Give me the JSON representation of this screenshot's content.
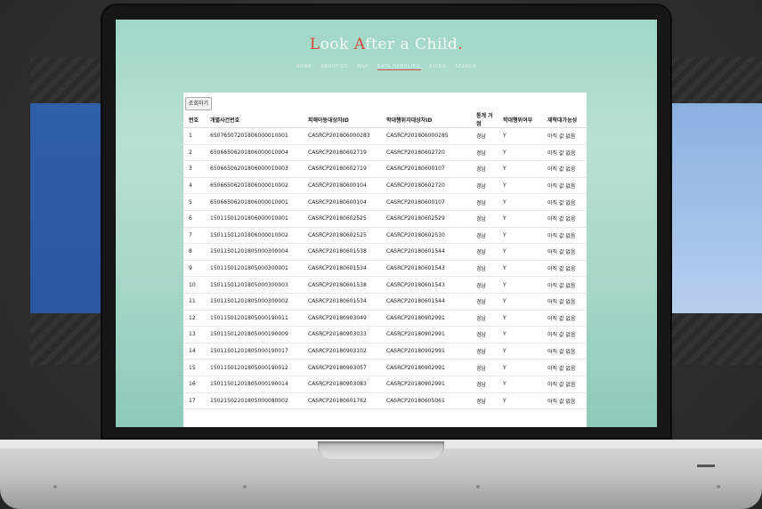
{
  "site": {
    "title_parts": [
      {
        "initial": "L",
        "rest": "ook "
      },
      {
        "initial": "A",
        "rest": "fter a Child"
      }
    ],
    "title_end": ".",
    "nav": [
      "HOME",
      "ABOUT US",
      "MAP",
      "DATA HANDLING",
      "VIDEO",
      "SEARCH"
    ],
    "active_nav": 3
  },
  "panel": {
    "query_button": "조회하기",
    "headers": [
      "번호",
      "개별사건번호",
      "피해아동대상자ID",
      "학대행위자대상자ID",
      "통계 거점",
      "학대행위여부",
      "재학대가능성"
    ],
    "rows": [
      [
        "1",
        "65076507201806000010001",
        "CASRCP201806000283",
        "CASRCP201806000285",
        "경남",
        "Y",
        "아직 값 없음"
      ],
      [
        "2",
        "65066506201806000010004",
        "CASRCP20180602719",
        "CASRCP20180602720",
        "경남",
        "Y",
        "아직 값 없음"
      ],
      [
        "3",
        "65066506201806000010003",
        "CASRCP20180602719",
        "CASRCP20180600107",
        "경남",
        "Y",
        "아직 값 없음"
      ],
      [
        "4",
        "65066506201806000010002",
        "CASRCP20180600104",
        "CASRCP20180602720",
        "경남",
        "Y",
        "아직 값 없음"
      ],
      [
        "5",
        "65066506201806000010001",
        "CASRCP20180600104",
        "CASRCP20180600107",
        "경남",
        "Y",
        "아직 값 없음"
      ],
      [
        "6",
        "15011501201806000010001",
        "CASRCP20180602525",
        "CASRCP20180602529",
        "경남",
        "Y",
        "아직 값 없음"
      ],
      [
        "7",
        "15011501201806000010002",
        "CASRCP20180602525",
        "CASRCP20180602530",
        "경남",
        "Y",
        "아직 값 없음"
      ],
      [
        "8",
        "15011501201805000300004",
        "CASRCP20180601538",
        "CASRCP20180601544",
        "경남",
        "Y",
        "아직 값 없음"
      ],
      [
        "9",
        "15011501201805000300001",
        "CASRCP20180601534",
        "CASRCP20180601543",
        "경남",
        "Y",
        "아직 값 없음"
      ],
      [
        "10",
        "15011501201805000300003",
        "CASRCP20180601538",
        "CASRCP20180601543",
        "경남",
        "Y",
        "아직 값 없음"
      ],
      [
        "11",
        "15011501201805000300002",
        "CASRCP20180601534",
        "CASRCP20180601544",
        "경남",
        "Y",
        "아직 값 없음"
      ],
      [
        "12",
        "15011501201805000190011",
        "CASRCP20180903049",
        "CASRCP20180902991",
        "경남",
        "Y",
        "아직 값 없음"
      ],
      [
        "13",
        "15011501201805000190009",
        "CASRCP20180903033",
        "CASRCP20180902991",
        "경남",
        "Y",
        "아직 값 없음"
      ],
      [
        "14",
        "15011501201805000190017",
        "CASRCP20180903102",
        "CASRCP20180902991",
        "경남",
        "Y",
        "아직 값 없음"
      ],
      [
        "15",
        "15011501201805000190012",
        "CASRCP20180903057",
        "CASRCP20180902991",
        "경남",
        "Y",
        "아직 값 없음"
      ],
      [
        "16",
        "15011501201805000190014",
        "CASRCP20180903083",
        "CASRCP20180902991",
        "경남",
        "Y",
        "아직 값 없음"
      ],
      [
        "17",
        "15021502201805000080002",
        "CASRCP20180601762",
        "CASRCP20180605061",
        "경남",
        "Y",
        "아직 값 없음"
      ]
    ]
  }
}
